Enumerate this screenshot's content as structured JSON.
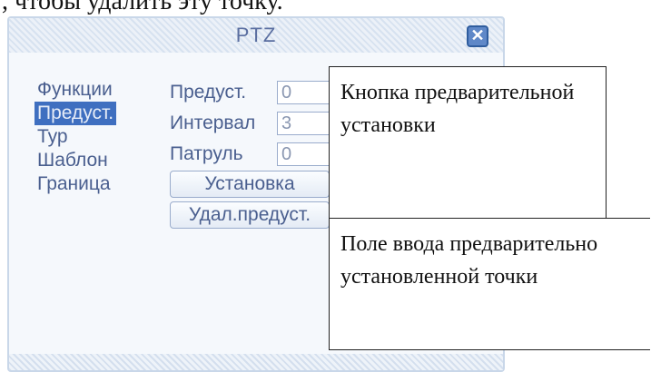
{
  "caption": ", чтобы удалить эту точку.",
  "dialog": {
    "title": "PTZ",
    "close_icon": "close-icon"
  },
  "menu": [
    {
      "label": "Функции",
      "selected": false
    },
    {
      "label": "Предуст.",
      "selected": true
    },
    {
      "label": "Тур",
      "selected": false
    },
    {
      "label": "Шаблон",
      "selected": false
    },
    {
      "label": "Граница",
      "selected": false
    }
  ],
  "form": {
    "preset_label": "Предуст.",
    "preset_value": "0",
    "interval_label": "Интервал",
    "interval_value": "3",
    "patrol_label": "Патруль",
    "patrol_value": "0",
    "set_button": "Установка",
    "delete_button": "Удал.предуст."
  },
  "callouts": {
    "preset_button": "Кнопка предварительной установки",
    "preset_field": "Поле ввода предварительно установленной точки"
  },
  "colors": {
    "selected": "#3f6fc0",
    "text": "#4a5f8f",
    "close": "#5f88c8"
  }
}
